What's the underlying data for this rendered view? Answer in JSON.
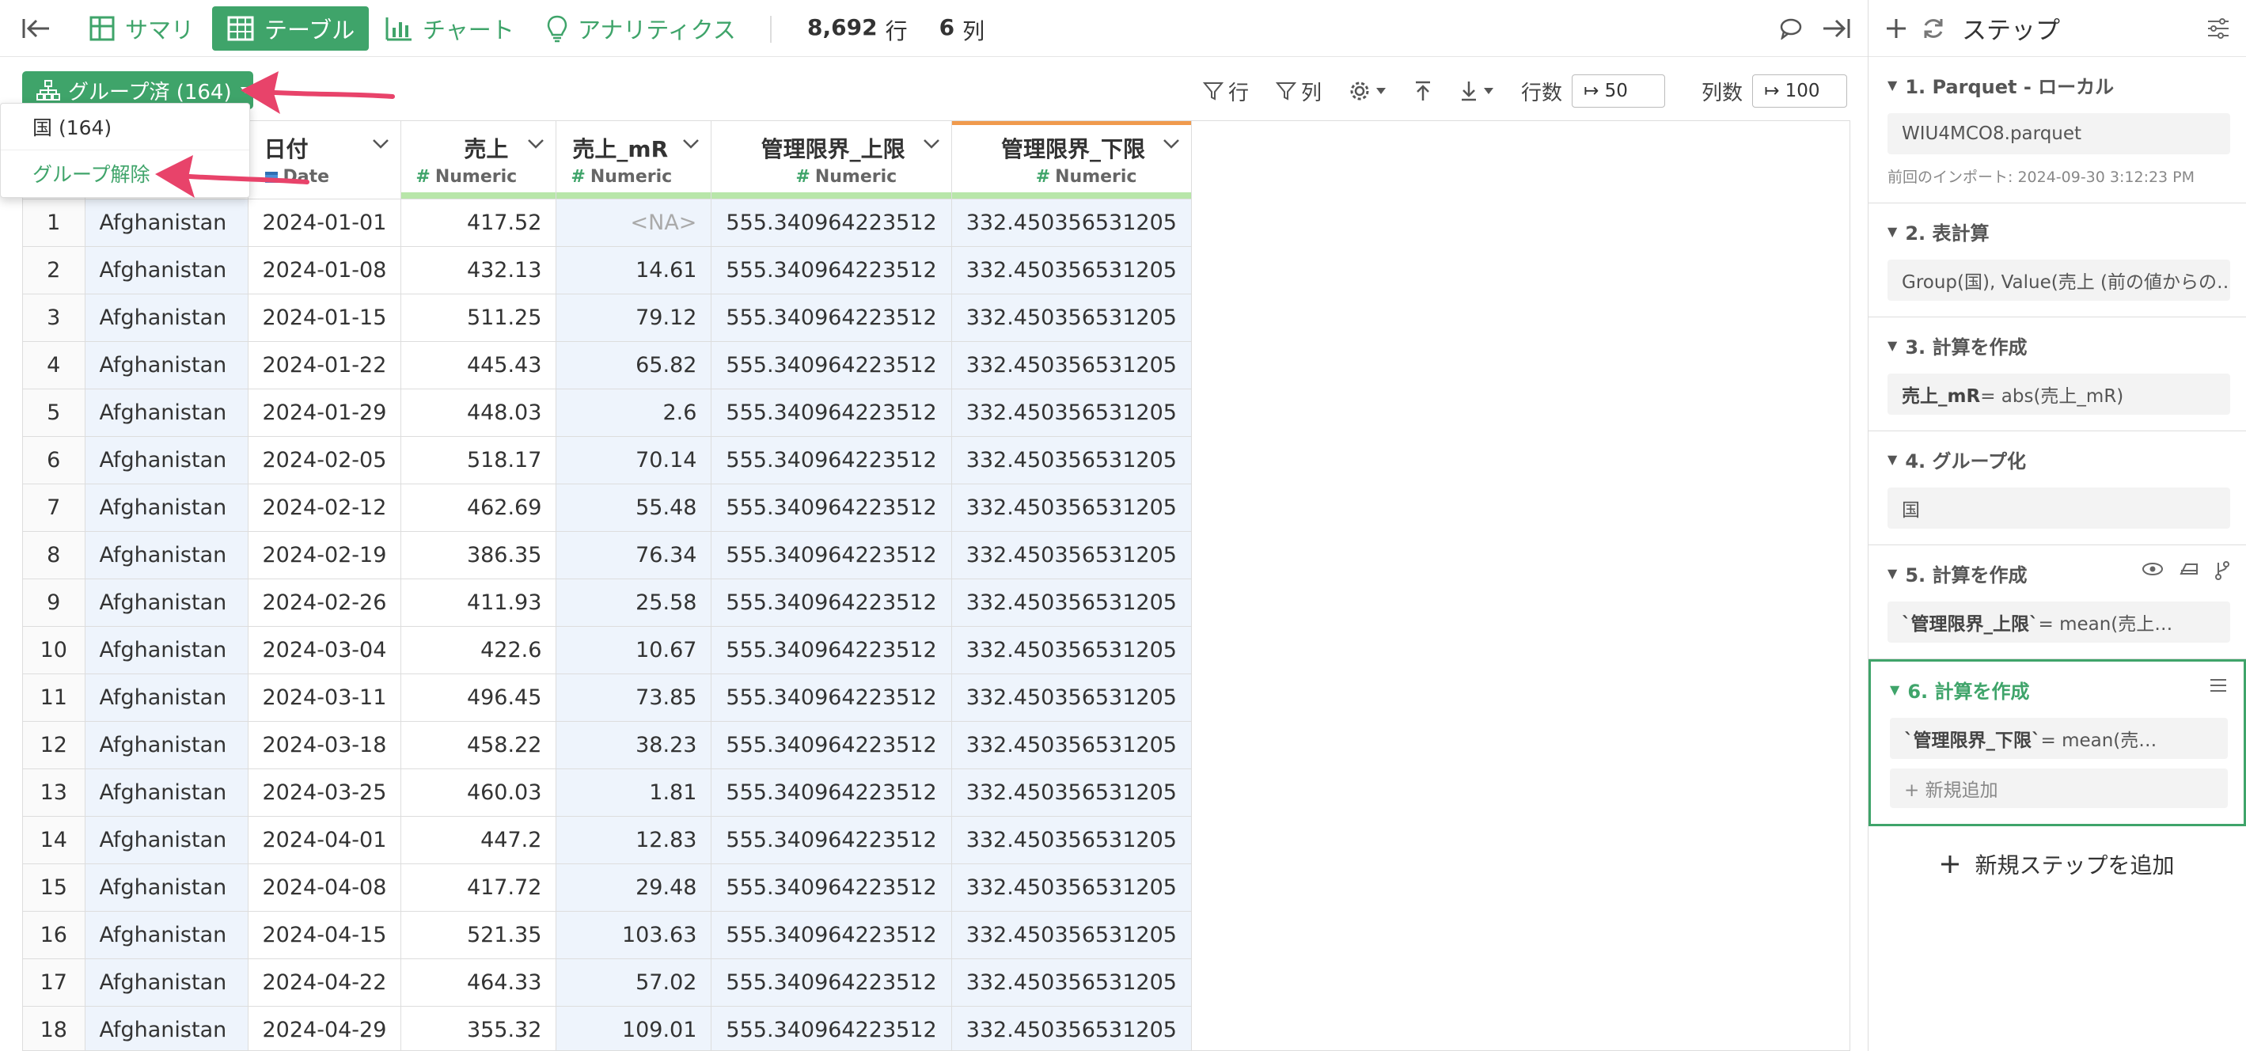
{
  "topbar": {
    "tabs": [
      {
        "label": "サマリ",
        "icon": "grid-icon"
      },
      {
        "label": "テーブル",
        "icon": "table-icon",
        "active": true
      },
      {
        "label": "チャート",
        "icon": "bar-chart-icon"
      },
      {
        "label": "アナリティクス",
        "icon": "lightbulb-icon"
      }
    ],
    "row_count": "8,692",
    "row_unit": "行",
    "col_count": "6",
    "col_unit": "列"
  },
  "toolbar": {
    "row_filter": "行",
    "col_filter": "列",
    "rows_label": "行数",
    "rows_value": "↦ 50",
    "cols_label": "列数",
    "cols_value": "↦ 100"
  },
  "group": {
    "button_label": "グループ済 (164)",
    "menu": {
      "group_item": "国 (164)",
      "ungroup_item": "グループ解除"
    }
  },
  "table": {
    "columns": [
      {
        "name": "日付",
        "type": "Date"
      },
      {
        "name": "売上",
        "type": "Numeric"
      },
      {
        "name": "売上_mR",
        "type": "Numeric"
      },
      {
        "name": "管理限界_上限",
        "type": "Numeric"
      },
      {
        "name": "管理限界_下限",
        "type": "Numeric"
      }
    ],
    "rows": [
      [
        "1",
        "Afghanistan",
        "2024-01-01",
        "417.52",
        "<NA>",
        "555.340964223512",
        "332.450356531205"
      ],
      [
        "2",
        "Afghanistan",
        "2024-01-08",
        "432.13",
        "14.61",
        "555.340964223512",
        "332.450356531205"
      ],
      [
        "3",
        "Afghanistan",
        "2024-01-15",
        "511.25",
        "79.12",
        "555.340964223512",
        "332.450356531205"
      ],
      [
        "4",
        "Afghanistan",
        "2024-01-22",
        "445.43",
        "65.82",
        "555.340964223512",
        "332.450356531205"
      ],
      [
        "5",
        "Afghanistan",
        "2024-01-29",
        "448.03",
        "2.6",
        "555.340964223512",
        "332.450356531205"
      ],
      [
        "6",
        "Afghanistan",
        "2024-02-05",
        "518.17",
        "70.14",
        "555.340964223512",
        "332.450356531205"
      ],
      [
        "7",
        "Afghanistan",
        "2024-02-12",
        "462.69",
        "55.48",
        "555.340964223512",
        "332.450356531205"
      ],
      [
        "8",
        "Afghanistan",
        "2024-02-19",
        "386.35",
        "76.34",
        "555.340964223512",
        "332.450356531205"
      ],
      [
        "9",
        "Afghanistan",
        "2024-02-26",
        "411.93",
        "25.58",
        "555.340964223512",
        "332.450356531205"
      ],
      [
        "10",
        "Afghanistan",
        "2024-03-04",
        "422.6",
        "10.67",
        "555.340964223512",
        "332.450356531205"
      ],
      [
        "11",
        "Afghanistan",
        "2024-03-11",
        "496.45",
        "73.85",
        "555.340964223512",
        "332.450356531205"
      ],
      [
        "12",
        "Afghanistan",
        "2024-03-18",
        "458.22",
        "38.23",
        "555.340964223512",
        "332.450356531205"
      ],
      [
        "13",
        "Afghanistan",
        "2024-03-25",
        "460.03",
        "1.81",
        "555.340964223512",
        "332.450356531205"
      ],
      [
        "14",
        "Afghanistan",
        "2024-04-01",
        "447.2",
        "12.83",
        "555.340964223512",
        "332.450356531205"
      ],
      [
        "15",
        "Afghanistan",
        "2024-04-08",
        "417.72",
        "29.48",
        "555.340964223512",
        "332.450356531205"
      ],
      [
        "16",
        "Afghanistan",
        "2024-04-15",
        "521.35",
        "103.63",
        "555.340964223512",
        "332.450356531205"
      ],
      [
        "17",
        "Afghanistan",
        "2024-04-22",
        "464.33",
        "57.02",
        "555.340964223512",
        "332.450356531205"
      ],
      [
        "18",
        "Afghanistan",
        "2024-04-29",
        "355.32",
        "109.01",
        "555.340964223512",
        "332.450356531205"
      ]
    ]
  },
  "steps_panel": {
    "title": "ステップ",
    "steps": [
      {
        "title": "1. Parquet - ローカル",
        "body": "WIU4MCO8.parquet",
        "meta": "前回のインポート: 2024-09-30 3:12:23 PM"
      },
      {
        "title": "2. 表計算",
        "body": "Group(国), Value(売上 (前の値からの…"
      },
      {
        "title": "3. 計算を作成",
        "body_bold": "売上_mR",
        "body_rest": " = abs(売上_mR)"
      },
      {
        "title": "4. グループ化",
        "body": "国"
      },
      {
        "title": "5. 計算を作成",
        "body_bold": "`管理限界_上限`",
        "body_rest": " = mean(売上…"
      },
      {
        "title": "6. 計算を作成",
        "body_bold": "`管理限界_下限`",
        "body_rest": " = mean(売…",
        "add_new": "+ 新規追加"
      }
    ],
    "add_step": "新規ステップを追加"
  },
  "colors": {
    "accent": "#3fa46a",
    "annotation_arrow": "#e8436a",
    "numeric_header_line": "#b8e6a9",
    "selected_column_top": "#f09a4d"
  }
}
